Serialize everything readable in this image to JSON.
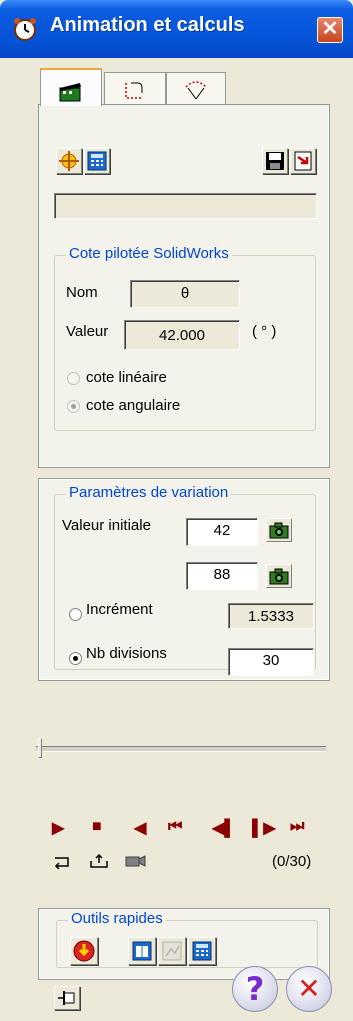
{
  "window": {
    "title": "Animation et calculs",
    "close_glyph": "✕"
  },
  "tabs": [
    {
      "name": "animation-tab",
      "icon": "film-clapper-icon"
    },
    {
      "name": "sketch-tab",
      "icon": "dashed-angle-icon"
    },
    {
      "name": "curve-tab",
      "icon": "arc-angle-icon"
    }
  ],
  "toolbar": {
    "icons": [
      "target-cross-icon",
      "calculator-icon",
      "save-icon",
      "export-icon"
    ]
  },
  "status_field": {
    "value": ""
  },
  "cote_group": {
    "title": "Cote pilotée SolidWorks",
    "nom_label": "Nom",
    "nom_value": "θ",
    "valeur_label": "Valeur",
    "valeur_value": "42.000",
    "unit": "( ° )",
    "options": [
      "cote linéaire",
      "cote angulaire"
    ],
    "selected": "cote angulaire"
  },
  "variation_group": {
    "title": "Paramètres de variation",
    "initial_label": "Valeur initiale",
    "initial_value": "42",
    "final_value": "88",
    "increment_label": "Incrément",
    "increment_value": "1.5333",
    "divisions_label": "Nb divisions",
    "divisions_value": "30",
    "selected": "Nb divisions"
  },
  "slider": {
    "position": 0
  },
  "media": {
    "play": "▶",
    "stop": "■",
    "step_back": "◀",
    "first": "⏮",
    "prev": "◀▌",
    "next": "▌▶",
    "last": "⏭"
  },
  "playback": {
    "counter": "(0/30)"
  },
  "quick_tools": {
    "title": "Outils rapides"
  },
  "footer": {
    "help": "?",
    "cancel": "✕"
  },
  "colors": {
    "titlebar": "#0653D8",
    "accent": "#0046D5",
    "media": "#8B0000"
  }
}
